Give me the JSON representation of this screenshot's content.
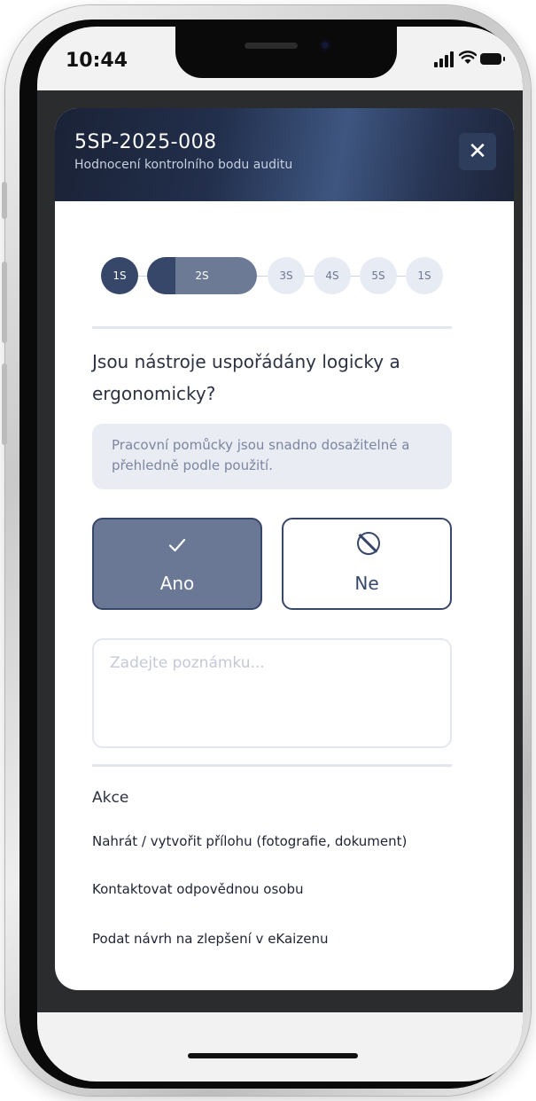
{
  "status_bar": {
    "time": "10:44",
    "icons": [
      "cellular-signal-icon",
      "wifi-icon",
      "battery-icon"
    ]
  },
  "modal": {
    "title": "5SP-2025-008",
    "subtitle": "Hodnocení kontrolního bodu auditu",
    "close_label": "✕"
  },
  "stepper": {
    "steps": [
      {
        "label": "1S",
        "state": "done"
      },
      {
        "label": "2S",
        "state": "current"
      },
      {
        "label": "3S",
        "state": "todo"
      },
      {
        "label": "4S",
        "state": "todo"
      },
      {
        "label": "5S",
        "state": "todo"
      },
      {
        "label": "1S",
        "state": "todo"
      }
    ]
  },
  "question": {
    "text": "Jsou nástroje uspořádány logicky a ergonomicky?",
    "hint": "Pracovní pomůcky jsou snadno dosažitelné a přehledně podle použití."
  },
  "answers": {
    "yes": {
      "label": "Ano",
      "icon": "checkmark-icon",
      "selected": true
    },
    "no": {
      "label": "Ne",
      "icon": "prohibited-icon",
      "selected": false
    }
  },
  "note": {
    "placeholder": "Zadejte poznámku..."
  },
  "actions": {
    "title": "Akce",
    "items": [
      "Nahrát / vytvořit přílohu (fotografie, dokument)",
      "Kontaktovat odpovědnou osobu",
      "Podat návrh na zlepšení v eKaizenu"
    ]
  },
  "colors": {
    "primary": "#37476a",
    "selected_fill": "#6a7795",
    "hint_background": "#e9ecf3",
    "header_gradient": [
      "#1a2236",
      "#3e5680",
      "#1c2438"
    ]
  }
}
